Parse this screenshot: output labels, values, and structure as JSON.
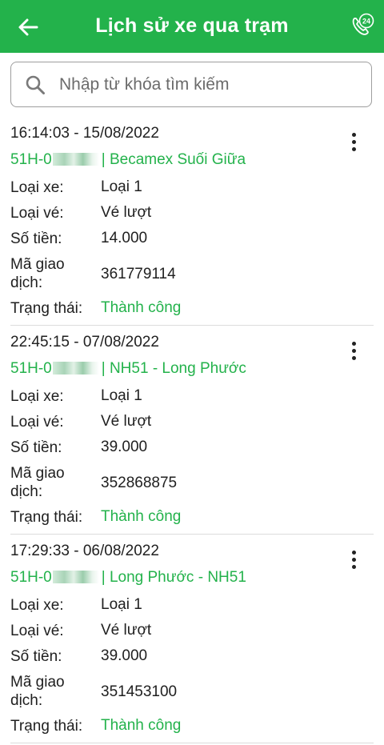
{
  "header": {
    "title": "Lịch sử xe qua trạm",
    "back_icon": "arrow-left-icon",
    "hotline_icon": "phone-24-icon",
    "hotline_badge": "24",
    "background": "#23b24b"
  },
  "search": {
    "placeholder": "Nhập từ khóa tìm kiếm",
    "value": ""
  },
  "labels": {
    "vehicle_type": "Loại xe:",
    "ticket_type": "Loại vé:",
    "amount": "Số tiền:",
    "transaction_id": "Mã giao dịch:",
    "status": "Trạng thái:"
  },
  "transactions": [
    {
      "time": "16:14:03 - 15/08/2022",
      "plate_prefix": "51H-0",
      "route": "| Becamex Suối Giữa",
      "vehicle_type": "Loại 1",
      "ticket_type": "Vé lượt",
      "amount": "14.000",
      "transaction_id": "361779114",
      "status": "Thành công"
    },
    {
      "time": "22:45:15 - 07/08/2022",
      "plate_prefix": "51H-0",
      "route": "| NH51 - Long Phước",
      "vehicle_type": "Loại 1",
      "ticket_type": "Vé lượt",
      "amount": "39.000",
      "transaction_id": "352868875",
      "status": "Thành công"
    },
    {
      "time": "17:29:33 - 06/08/2022",
      "plate_prefix": "51H-0",
      "route": "| Long Phước - NH51",
      "vehicle_type": "Loại 1",
      "ticket_type": "Vé lượt",
      "amount": "39.000",
      "transaction_id": "351453100",
      "status": "Thành công"
    }
  ],
  "colors": {
    "accent": "#23b24b",
    "divider": "#dcdcdc"
  }
}
